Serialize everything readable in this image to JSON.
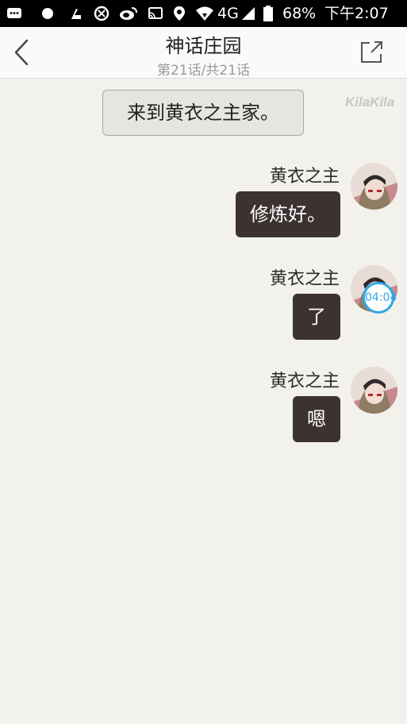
{
  "status_bar": {
    "network": "4G",
    "battery": "68%",
    "time": "下午2:07"
  },
  "header": {
    "title": "神话庄园",
    "subtitle": "第21话/共21话",
    "back_icon": "chevron-left-icon",
    "share_icon": "share-icon"
  },
  "chat": {
    "watermark": "KilaKila",
    "narration": "来到黄衣之主家。",
    "messages": [
      {
        "speaker": "黄衣之主",
        "text": "修炼好。"
      },
      {
        "speaker": "黄衣之主",
        "text": "了",
        "timer": "04:04"
      },
      {
        "speaker": "黄衣之主",
        "text": "嗯"
      }
    ]
  },
  "colors": {
    "background": "#f3f1ec",
    "bubble": "#3b3231",
    "timer_accent": "#2ea8e8"
  }
}
